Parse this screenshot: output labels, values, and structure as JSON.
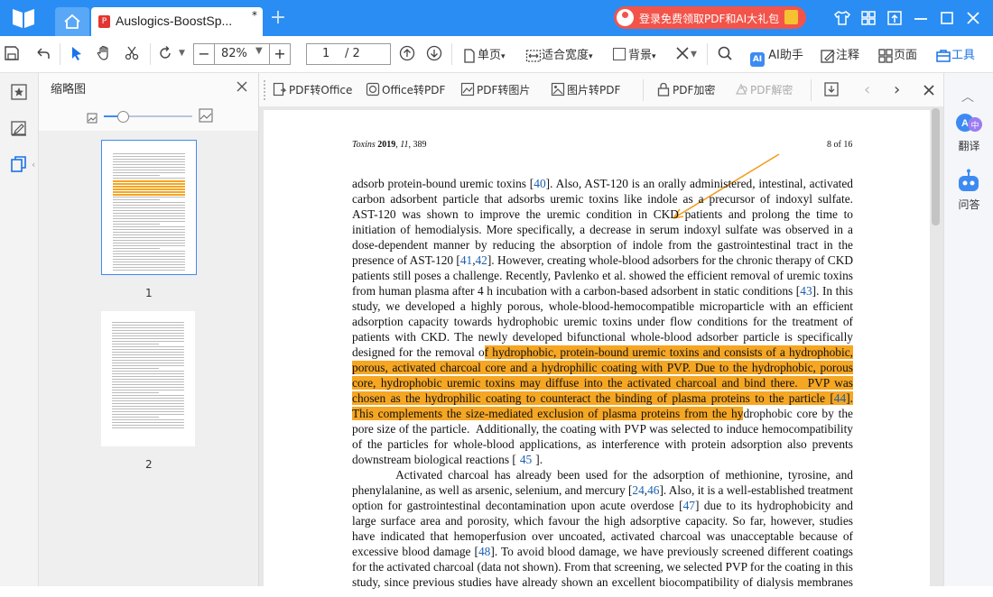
{
  "titlebar": {
    "doc_tab_title": "Auslogics-BoostSp...",
    "modified_marker": "*",
    "promo_text": "登录免费领取PDF和AI大礼包",
    "colors": {
      "titlebar_bg": "#2a8df3",
      "promo_bg": "#f2544a"
    }
  },
  "toolbar": {
    "zoom": "82%",
    "page_current": "1",
    "page_total": "/ 2",
    "single_page": "单页",
    "fit_width": "适合宽度",
    "background": "背景",
    "ai_assistant": "AI助手",
    "annotate": "注释",
    "pages": "页面",
    "tools": "工具",
    "ai_badge": "AI"
  },
  "thumbnails": {
    "title": "缩略图",
    "pages": [
      {
        "label": "1"
      },
      {
        "label": "2"
      }
    ]
  },
  "subtoolbar": {
    "pdf_to_office": "PDF转Office",
    "office_to_pdf": "Office转PDF",
    "pdf_to_image": "PDF转图片",
    "image_to_pdf": "图片转PDF",
    "pdf_encrypt": "PDF加密",
    "pdf_decrypt": "PDF解密"
  },
  "right_panel": {
    "translate": "翻译",
    "qa": "问答"
  },
  "document": {
    "running_head": {
      "journal": "Toxins",
      "year": "2019",
      "volume": "11",
      "page": "389"
    },
    "page_of": "8 of 16",
    "lines": [
      [
        {
          "t": "adsorb protein-bound uremic toxins ["
        },
        {
          "t": "40",
          "c": "ref"
        },
        {
          "t": "]. Also, AST-120 is an orally administered, intestinal, activated"
        }
      ],
      [
        {
          "t": "carbon adsorbent particle that adsorbs uremic toxins like indole as a precursor of indoxyl sulfate."
        }
      ],
      [
        {
          "t": "AST-120 was shown to improve the uremic condition in CKD patients and prolong the time to"
        }
      ],
      [
        {
          "t": "initiation of hemodialysis. More specifically, a decrease in serum indoxyl sulfate was observed in a"
        }
      ],
      [
        {
          "t": "dose-dependent manner by reducing the absorption of indole from the gastrointestinal tract in the"
        }
      ],
      [
        {
          "t": "presence of AST-120 ["
        },
        {
          "t": "41",
          "c": "ref"
        },
        {
          "t": ","
        },
        {
          "t": "42",
          "c": "ref"
        },
        {
          "t": "]. However, creating whole-blood adsorbers for the chronic therapy of CKD"
        }
      ],
      [
        {
          "t": "patients still poses a challenge. Recently, Pavlenko et al. showed the efficient removal of uremic toxins"
        }
      ],
      [
        {
          "t": "from human plasma after 4 h incubation with a carbon-based adsorbent in static conditions ["
        },
        {
          "t": "43",
          "c": "ref"
        },
        {
          "t": "]. In this"
        }
      ],
      [
        {
          "t": "study, we developed a highly porous, whole-blood-hemocompatible microparticle with an efficient"
        }
      ],
      [
        {
          "t": "adsorption capacity towards hydrophobic uremic toxins under flow conditions for the treatment of"
        }
      ],
      [
        {
          "t": "patients with CKD. The newly developed bifunctional whole-blood adsorber particle is specifically"
        }
      ],
      [
        {
          "t": "designed for the removal o"
        },
        {
          "t": "f hydrophobic, protein-bound uremic toxins and consists of a hydrophobic,",
          "c": "hl"
        }
      ],
      [
        {
          "t": "porous, activated charcoal core and a hydrophilic coating with PVP. Due to the hydrophobic, porous",
          "c": "hl"
        }
      ],
      [
        {
          "t": "core, hydrophobic uremic toxins may diffuse into the activated charcoal and bind there.  PVP was",
          "c": "hl"
        }
      ],
      [
        {
          "t": "chosen as the hydrophilic coating to counteract the binding of plasma proteins to the particle [",
          "c": "hl"
        },
        {
          "t": "44",
          "c": "hl ref"
        },
        {
          "t": "].",
          "c": "hl"
        }
      ],
      [
        {
          "t": "This complements the size-mediated exclusion of plasma proteins from the hy",
          "c": "hl"
        },
        {
          "t": "drophobic core by the"
        }
      ],
      [
        {
          "t": "pore size of the particle.  Additionally, the coating with PVP was selected to induce hemocompatibility"
        }
      ],
      [
        {
          "t": "of the particles for whole-blood applications, as interference with protein adsorption also prevents"
        }
      ],
      [
        {
          "t": "downstream biological reactions ["
        },
        {
          "t": "45",
          "c": "ref"
        },
        {
          "t": "]."
        }
      ],
      [
        {
          "t": "        Activated charcoal has already been used for the adsorption of methionine, tyrosine, and"
        }
      ],
      [
        {
          "t": "phenylalanine, as well as arsenic, selenium, and mercury ["
        },
        {
          "t": "24",
          "c": "ref"
        },
        {
          "t": ","
        },
        {
          "t": "46",
          "c": "ref"
        },
        {
          "t": "]. Also, it is a well-established treatment"
        }
      ],
      [
        {
          "t": "option for gastrointestinal decontamination upon acute overdose ["
        },
        {
          "t": "47",
          "c": "ref"
        },
        {
          "t": "] due to its hydrophobicity and"
        }
      ],
      [
        {
          "t": "large surface area and porosity, which favour the high adsorptive capacity. So far, however, studies"
        }
      ],
      [
        {
          "t": "have indicated that hemoperfusion over uncoated, activated charcoal was unacceptable because of"
        }
      ],
      [
        {
          "t": "excessive blood damage ["
        },
        {
          "t": "48",
          "c": "ref"
        },
        {
          "t": "]. To avoid blood damage, we have previously screened different coatings"
        }
      ],
      [
        {
          "t": "for the activated charcoal (data not shown). From that screening, we selected PVP for the coating in this"
        }
      ],
      [
        {
          "t": "study, since previous studies have already shown an excellent biocompatibility of dialysis membranes"
        }
      ]
    ],
    "last_line_indices": [
      18
    ]
  }
}
